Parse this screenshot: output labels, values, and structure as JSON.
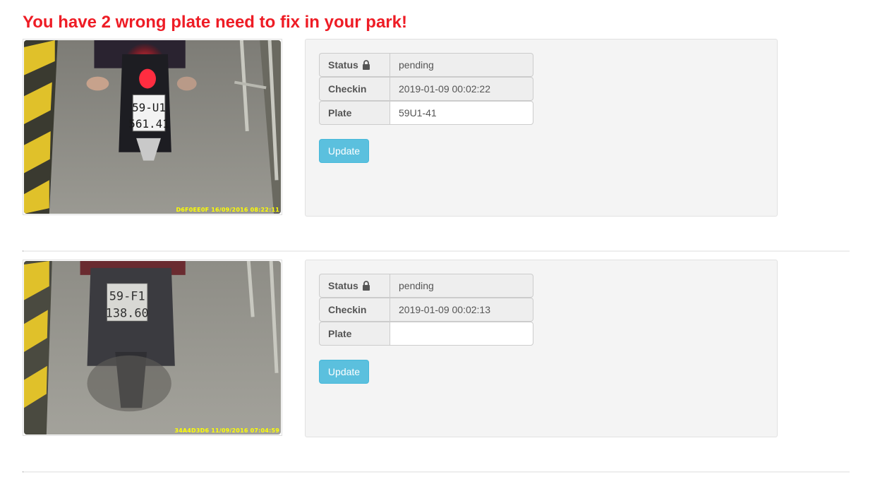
{
  "header": {
    "title": "You have 2 wrong plate need to fix in your park!"
  },
  "colors": {
    "title": "#ee1c25",
    "button": "#5bc0de",
    "panel": "#f4f4f4",
    "stamp": "#ffff00"
  },
  "records": [
    {
      "photo": {
        "plate_line1": "59-U1",
        "plate_line2": "561.41",
        "stamp": "D6F0EE0F  16/09/2016 08:22:11",
        "icon": "camera-photo"
      },
      "status": {
        "label": "Status",
        "value": "pending",
        "icon": "lock-icon"
      },
      "checkin": {
        "label": "Checkin",
        "value": "2019-01-09 00:02:22"
      },
      "plate": {
        "label": "Plate",
        "value": "59U1-41"
      },
      "update_label": "Update"
    },
    {
      "photo": {
        "plate_line1": "59-F1",
        "plate_line2": "138.60",
        "stamp": "34A4D3D6  11/09/2016 07:04:59",
        "icon": "camera-photo"
      },
      "status": {
        "label": "Status",
        "value": "pending",
        "icon": "lock-icon"
      },
      "checkin": {
        "label": "Checkin",
        "value": "2019-01-09 00:02:13"
      },
      "plate": {
        "label": "Plate",
        "value": ""
      },
      "update_label": "Update"
    }
  ]
}
